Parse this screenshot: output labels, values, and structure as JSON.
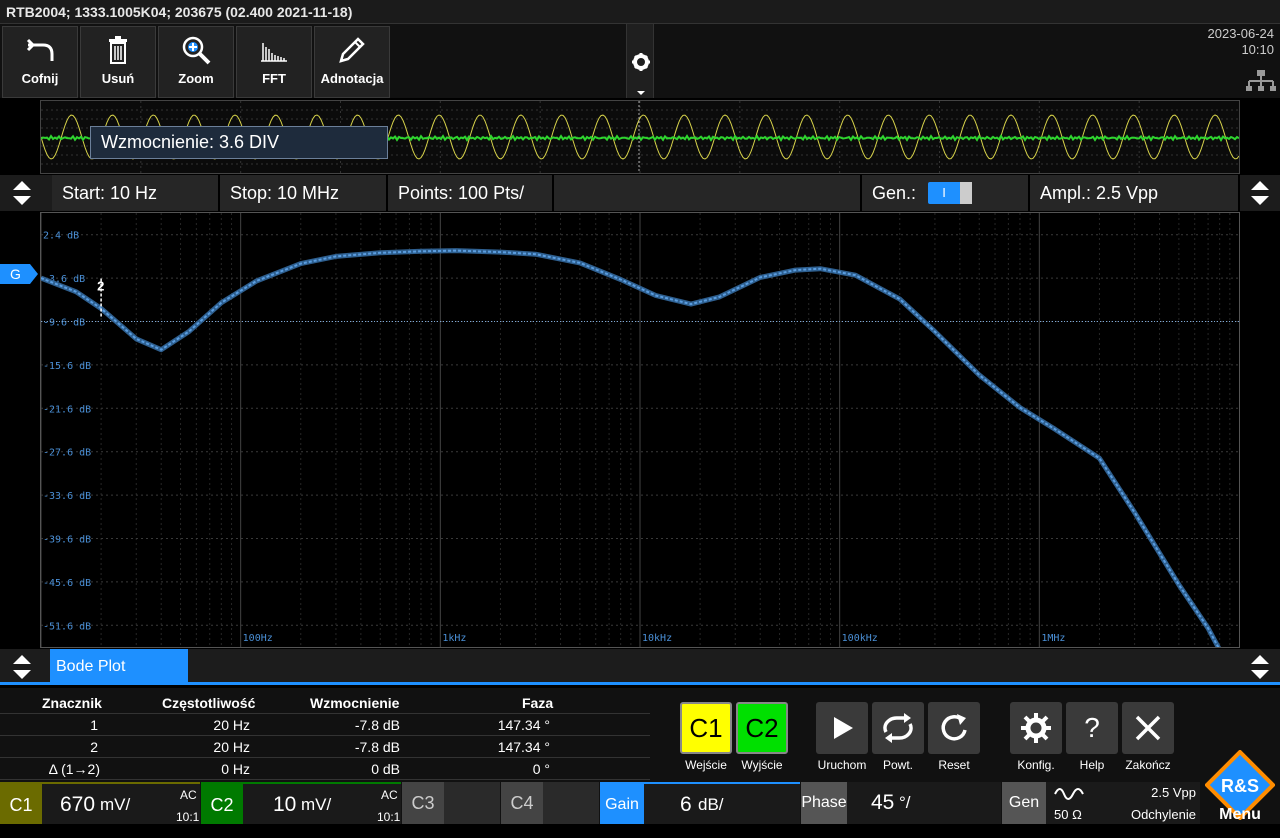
{
  "title": "RTB2004; 1333.1005K04; 203675 (02.400 2021-11-18)",
  "toolbar": {
    "buttons": [
      {
        "label": "Cofnij",
        "icon": "undo-icon"
      },
      {
        "label": "Usuń",
        "icon": "trash-icon"
      },
      {
        "label": "Zoom",
        "icon": "zoom-icon"
      },
      {
        "label": "FFT",
        "icon": "fft-icon"
      },
      {
        "label": "Adnotacja",
        "icon": "pencil-icon"
      }
    ]
  },
  "clock": {
    "date": "2023-06-24",
    "time": "10:10"
  },
  "tooltip": "Wzmocnienie: 3.6 DIV",
  "settings": {
    "start": "Start: 10 Hz",
    "stop": "Stop: 10 MHz",
    "points": "Points: 100 Pts/",
    "gen": "Gen.:",
    "gen_toggle": "I",
    "ampl": "Ampl.: 2.5 Vpp"
  },
  "chart_data": {
    "type": "line",
    "title": "",
    "x_scale": "log",
    "xlim": [
      10,
      10000000
    ],
    "ylim": [
      -54.6,
      5.4
    ],
    "x_ticks": [
      {
        "value": 100,
        "label": "100Hz"
      },
      {
        "value": 1000,
        "label": "1kHz"
      },
      {
        "value": 10000,
        "label": "10kHz"
      },
      {
        "value": 100000,
        "label": "100kHz"
      },
      {
        "value": 1000000,
        "label": "1MHz"
      }
    ],
    "y_ticks": [
      {
        "value": 2.4,
        "label": "2.4 dB"
      },
      {
        "value": -3.6,
        "label": "-3.6 dB"
      },
      {
        "value": -9.6,
        "label": "-9.6 dB"
      },
      {
        "value": -15.6,
        "label": "-15.6 dB"
      },
      {
        "value": -21.6,
        "label": "-21.6 dB"
      },
      {
        "value": -27.6,
        "label": "-27.6 dB"
      },
      {
        "value": -33.6,
        "label": "-33.6 dB"
      },
      {
        "value": -39.6,
        "label": "-39.6 dB"
      },
      {
        "value": -45.6,
        "label": "-45.6 dB"
      },
      {
        "value": -51.6,
        "label": "-51.6 dB"
      }
    ],
    "series": [
      {
        "x": [
          10,
          15,
          20,
          30,
          40,
          55,
          80,
          120,
          200,
          300,
          500,
          800,
          1200,
          2000,
          3000,
          5000,
          8000,
          12000,
          18000,
          25000,
          40000,
          60000,
          80000,
          120000,
          200000,
          300000,
          500000,
          800000,
          1200000,
          2000000,
          3000000,
          5000000,
          7000000,
          10000000
        ],
        "y": [
          -3.6,
          -5.5,
          -7.8,
          -12.0,
          -13.5,
          -11.0,
          -7.0,
          -4.0,
          -1.6,
          -0.6,
          -0.1,
          0.1,
          0.2,
          0.0,
          -0.3,
          -1.5,
          -3.8,
          -6.0,
          -7.2,
          -6.2,
          -3.5,
          -2.5,
          -2.3,
          -3.2,
          -6.5,
          -11.0,
          -17.0,
          -21.5,
          -24.5,
          -28.5,
          -36.0,
          -46.0,
          -52.0,
          -60.0
        ]
      }
    ],
    "markers": [
      {
        "label": "2",
        "x": 20,
        "y": -7.8
      }
    ],
    "ref_line": -9.6,
    "grid": true
  },
  "tab": "Bode Plot",
  "results": {
    "headers": [
      "Znacznik",
      "Częstotliwość",
      "Wzmocnienie",
      "Faza"
    ],
    "rows": [
      [
        "1",
        "20 Hz",
        "-7.8 dB",
        "147.34 °"
      ],
      [
        "2",
        "20 Hz",
        "-7.8 dB",
        "147.34 °"
      ],
      [
        "Δ (1→2)",
        "0 Hz",
        "0 dB",
        "0 °"
      ]
    ]
  },
  "controls": {
    "c1": "C1",
    "c1_label": "Wejście",
    "c2": "C2",
    "c2_label": "Wyjście",
    "run": "Uruchom",
    "repeat": "Powt.",
    "reset": "Reset",
    "config": "Konfig.",
    "help": "Help",
    "help_glyph": "?",
    "exit": "Zakończ"
  },
  "bottom": {
    "c1": "C1",
    "c1_scale": "670",
    "c1_unit": "mV/",
    "c1_coupling": "AC",
    "c1_probe": "10:1",
    "c2": "C2",
    "c2_scale": "10",
    "c2_unit": "mV/",
    "c2_coupling": "AC",
    "c2_probe": "10:1",
    "c3": "C3",
    "c4": "C4",
    "gain": "Gain",
    "gain_scale": "6",
    "gain_unit": "dB/",
    "phase": "Phase",
    "phase_scale": "45",
    "phase_unit": "°/",
    "gen": "Gen",
    "gen_ampl": "2.5 Vpp",
    "gen_imp": "50 Ω",
    "gen_mode": "Odchylenie"
  },
  "menu_label": "Menu",
  "logo_text": "R&S",
  "colors": {
    "accent": "#1e90ff",
    "trace": "#4a8fd6",
    "c1": "#ffff00",
    "c2": "#00e000",
    "grid": "#3a3a3a"
  }
}
